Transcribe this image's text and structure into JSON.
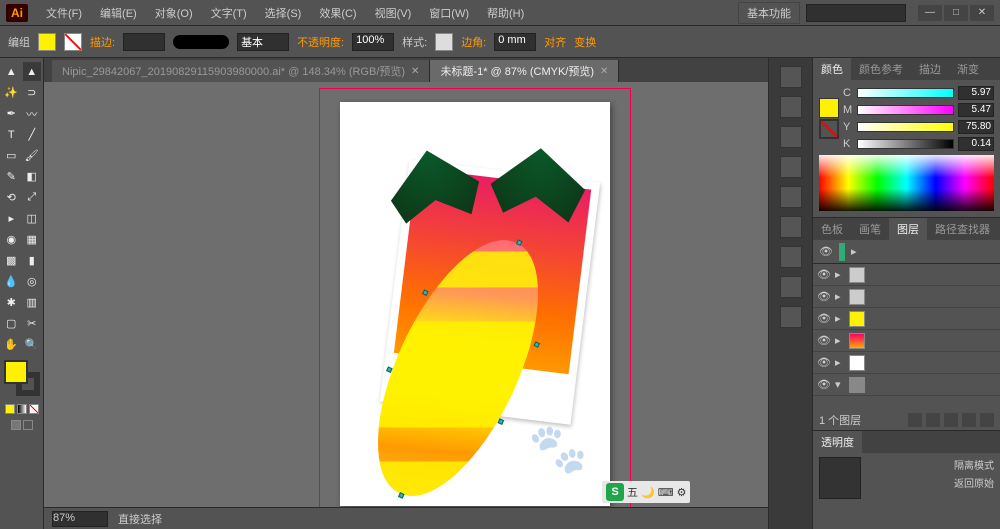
{
  "app": {
    "logo": "Ai",
    "workspace": "基本功能"
  },
  "menu": {
    "file": "文件(F)",
    "edit": "编辑(E)",
    "object": "对象(O)",
    "type": "文字(T)",
    "select": "选择(S)",
    "effect": "效果(C)",
    "view": "视图(V)",
    "window": "窗口(W)",
    "help": "帮助(H)"
  },
  "options": {
    "group_label": "编组",
    "stroke_label": "描边:",
    "stroke_value": "",
    "profile_label": "基本",
    "opacity_label": "不透明度:",
    "opacity_value": "100%",
    "style_label": "样式:",
    "corner_label": "边角:",
    "corner_value": "0 mm",
    "align_label": "对齐",
    "transform_label": "变换"
  },
  "tabs": {
    "inactive": "Nipic_29842067_20190829115903980000.ai* @ 148.34% (RGB/预览)",
    "active": "未标题-1* @ 87% (CMYK/预览)"
  },
  "status": {
    "zoom": "87%",
    "mode": "直接选择"
  },
  "color_panel": {
    "tab_color": "颜色",
    "tab_guide": "颜色参考",
    "tab_stroke": "描边",
    "tab_grad": "渐变",
    "c_label": "C",
    "c_val": "5.97",
    "m_label": "M",
    "m_val": "5.47",
    "y_label": "Y",
    "y_val": "75.80",
    "k_label": "K",
    "k_val": "0.14"
  },
  "layers_panel": {
    "tab_swatches": "色板",
    "tab_brushes": "画笔",
    "tab_layers": "图层",
    "tab_pathfinder": "路径查找器",
    "count": "1 个图层"
  },
  "transparency_panel": {
    "tab": "透明度"
  },
  "right_actions": {
    "isolate": "隔离模式",
    "back": "返回原始"
  },
  "ime": {
    "badge": "S",
    "text": "五"
  }
}
